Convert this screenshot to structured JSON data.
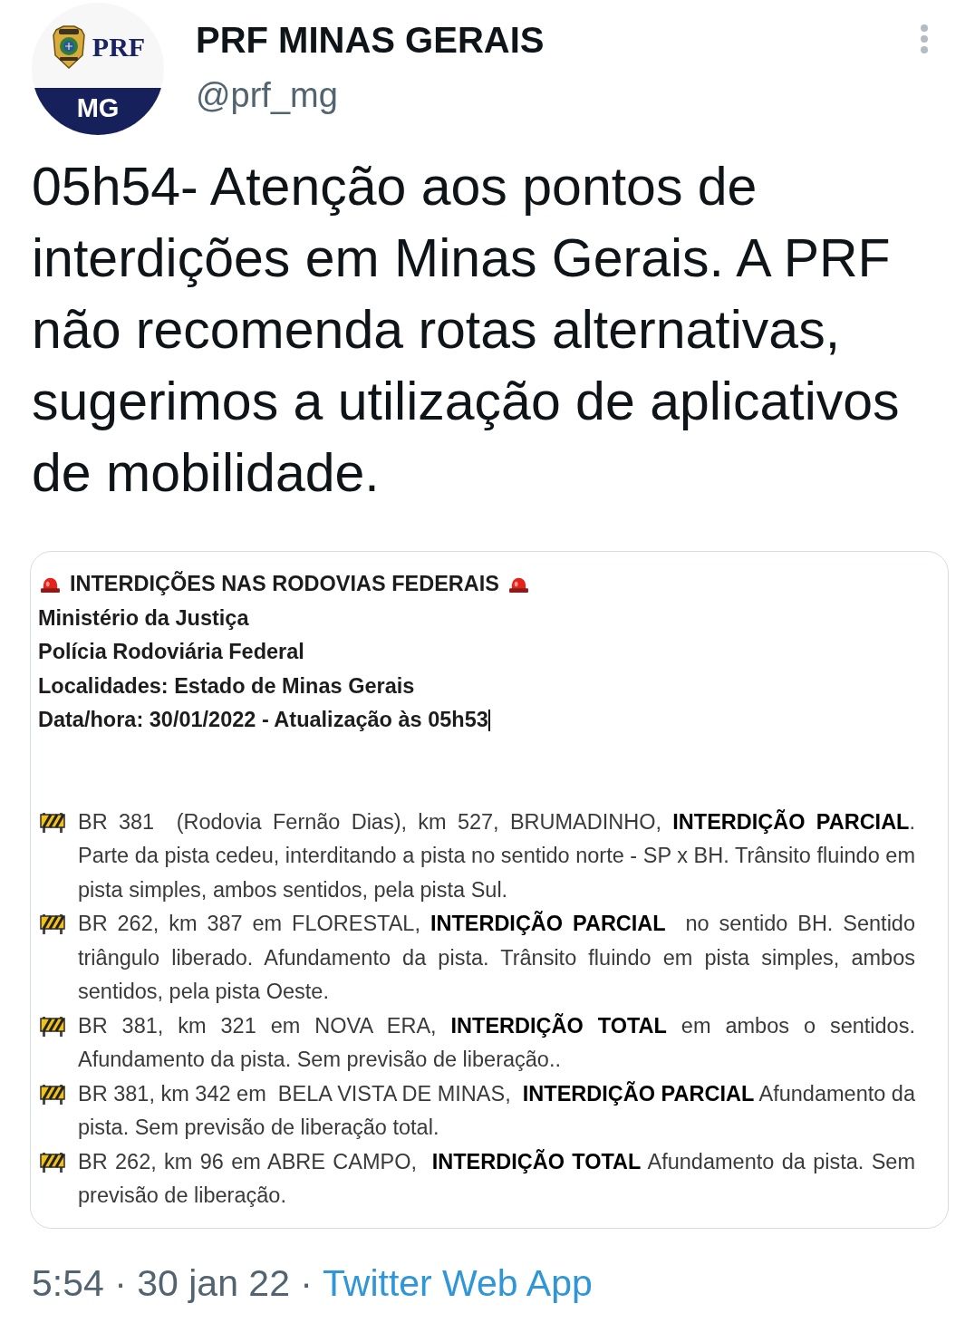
{
  "author": {
    "avatar": {
      "badge_text": "PRF",
      "banner_text": "MG"
    },
    "name": "PRF MINAS GERAIS",
    "handle": "@prf_mg"
  },
  "tweet": {
    "text": "05h54- Atenção aos pontos de interdições em Minas Gerais. A PRF não recomenda rotas alternativas, sugerimos a utilização de aplicativos de mobilidade."
  },
  "attached_document": {
    "heading": "INTERDIÇÕES NAS RODOVIAS FEDERAIS",
    "header_lines": [
      "Ministério da Justiça",
      "Polícia Rodoviária Federal",
      "Localidades: Estado de Minas Gerais",
      "Data/hora: 30/01/2022 - Atualização às 05h53"
    ],
    "closures": [
      "BR 381  (Rodovia Fernão Dias), km 527, BRUMADINHO, **INTERDIÇÃO PARCIAL**. Parte da pista cedeu, interditando a pista no sentido norte - SP x BH. Trânsito fluindo em pista simples, ambos sentidos, pela pista Sul.",
      "BR 262, km 387 em FLORESTAL, **INTERDIÇÃO PARCIAL**  no sentido BH. Sentido triângulo liberado. Afundamento da pista. Trânsito fluindo em pista simples, ambos sentidos, pela pista Oeste.",
      "BR 381, km 321 em NOVA ERA, **INTERDIÇÃO TOTAL** em ambos o sentidos. Afundamento da pista. Sem previsão de liberação..",
      "BR 381, km 342 em  BELA VISTA DE MINAS,  **INTERDIÇÃO PARCIAL** Afundamento da pista. Sem previsão de liberação total.",
      "BR 262, km 96 em ABRE CAMPO,  **INTERDIÇÃO TOTAL** Afundamento da pista. Sem previsão de liberação."
    ]
  },
  "footer": {
    "timestamp": "5:54 · 30 jan 22 ·",
    "source": "Twitter Web App"
  }
}
